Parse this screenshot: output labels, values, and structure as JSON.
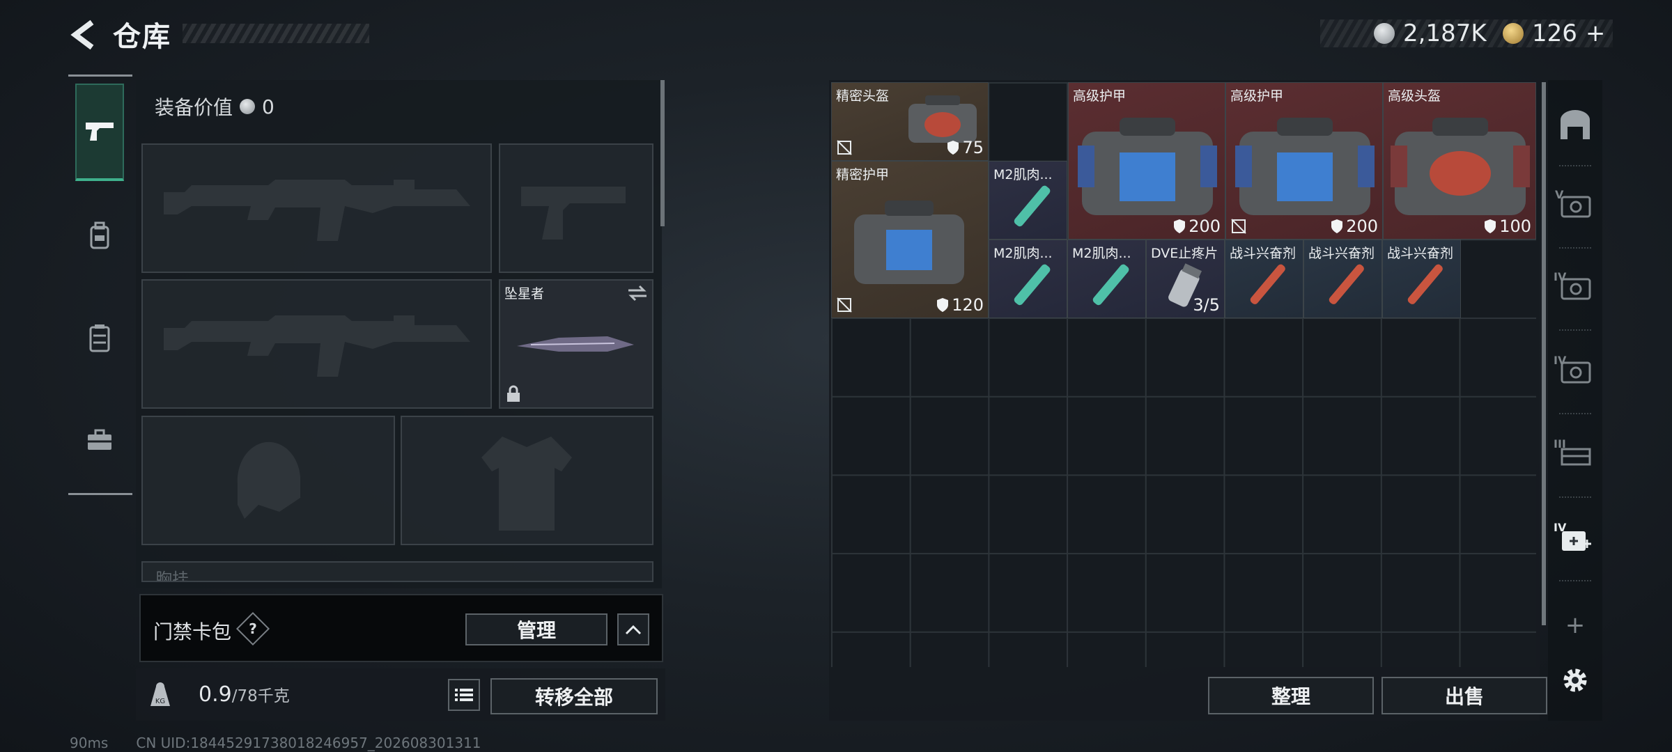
{
  "header": {
    "title": "仓库",
    "currency_1": "2,187K",
    "currency_2": "126",
    "currency_2_plus": "+"
  },
  "loadout": {
    "equip_value_label": "装备价值",
    "equip_value": "0",
    "melee_name": "坠星者",
    "chest_rig_label": "胸挂",
    "keycard_label": "门禁卡包",
    "keycard_help": "?",
    "manage_label": "管理",
    "weight_value": "0.9",
    "weight_max": "/78千克",
    "weight_icon_text": "KG",
    "transfer_all_label": "转移全部"
  },
  "storage": {
    "items": [
      {
        "name": "精密头盔",
        "value": "75"
      },
      {
        "name": "高级护甲",
        "value": "200"
      },
      {
        "name": "高级护甲",
        "value": "200"
      },
      {
        "name": "高级头盔",
        "value": "100"
      },
      {
        "name": "精密护甲",
        "value": "120"
      },
      {
        "name": "M2肌肉...",
        "value": ""
      },
      {
        "name": "M2肌肉...",
        "value": ""
      },
      {
        "name": "M2肌肉...",
        "value": ""
      },
      {
        "name": "DVE止疼片",
        "value": "3/5"
      },
      {
        "name": "战斗兴奋剂",
        "value": ""
      },
      {
        "name": "战斗兴奋剂",
        "value": ""
      },
      {
        "name": "战斗兴奋剂",
        "value": ""
      }
    ],
    "tidy_label": "整理",
    "sell_label": "出售"
  },
  "right_filters": {
    "tier_v_1": "V",
    "tier_iv_1": "IV",
    "tier_iv_2": "IV",
    "tier_iii": "III",
    "tier_iv_add": "IV",
    "add": "+"
  },
  "status": {
    "ping": "90ms",
    "uid": "CN UID:18445291738018246957_202608301311"
  },
  "colors": {
    "accent_green": "#3fb08c",
    "item_brown": "#4a3f33",
    "item_red": "#5b2e31",
    "item_purple": "#2e3043",
    "item_blue": "#2a3644"
  },
  "icons": [
    "back-arrow-icon",
    "silver-coin-icon",
    "gold-coin-icon",
    "pistol-icon",
    "backpack-icon",
    "chest-rig-icon",
    "toolbox-icon",
    "no-sell-icon",
    "shield-icon",
    "lock-icon",
    "swap-icon",
    "list-icon",
    "chevron-up-icon",
    "gear-icon"
  ]
}
